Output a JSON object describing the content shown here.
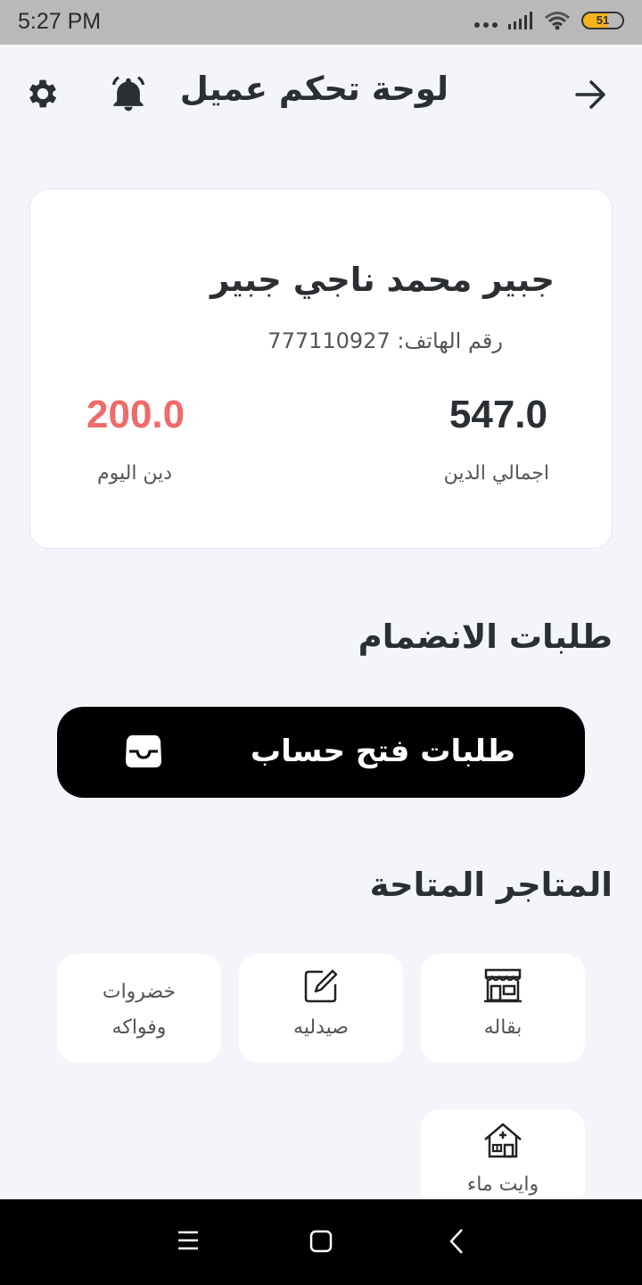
{
  "status_bar": {
    "time": "5:27 PM",
    "battery": "51"
  },
  "header": {
    "title": "لوحة تحكم عميل",
    "icons": [
      "gear-icon",
      "bell-icon",
      "arrow-right-icon"
    ]
  },
  "customer": {
    "name": "جبير محمد ناجي جبير",
    "phone": "رقم الهاتف: 777110927",
    "total_debt_value": "547.0",
    "total_debt_label": "اجمالي الدين",
    "today_debt_value": "200.0",
    "today_debt_label": "دين اليوم",
    "today_debt_color": "#ef6a6a"
  },
  "join_requests": {
    "title": "طلبات الانضمام",
    "button_label": "طلبات فتح حساب",
    "button_icon": "inbox-icon"
  },
  "stores": {
    "title": "المتاجر المتاحة",
    "items": [
      {
        "label": "بقاله",
        "icon": "store-icon"
      },
      {
        "label": "صيدليه",
        "icon": "edit-icon"
      },
      {
        "label_line1": "خضروات",
        "label_line2": "وفواكه",
        "icon": ""
      },
      {
        "label": "وايت ماء",
        "icon": "house-icon"
      }
    ]
  },
  "nav": {
    "icons": [
      "menu-icon",
      "home-square-icon",
      "back-chevron-icon"
    ]
  }
}
